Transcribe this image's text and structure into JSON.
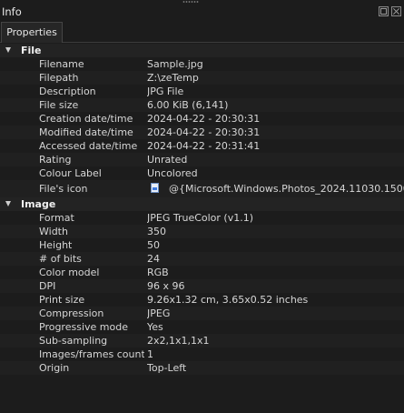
{
  "window": {
    "title": "Info"
  },
  "tabs": [
    {
      "label": "Properties"
    }
  ],
  "sections": [
    {
      "label": "File",
      "rows": [
        {
          "key": "Filename",
          "value": "Sample.jpg"
        },
        {
          "key": "Filepath",
          "value": "Z:\\zeTemp"
        },
        {
          "key": "Description",
          "value": "JPG File"
        },
        {
          "key": "File size",
          "value": "6.00 KiB (6,141)"
        },
        {
          "key": "Creation date/time",
          "value": "2024-04-22 - 20:30:31"
        },
        {
          "key": "Modified date/time",
          "value": "2024-04-22 - 20:30:31"
        },
        {
          "key": "Accessed date/time",
          "value": "2024-04-22 - 20:31:41"
        },
        {
          "key": "Rating",
          "value": "Unrated"
        },
        {
          "key": "Colour Label",
          "value": "Uncolored"
        },
        {
          "key": "File's icon",
          "value": "@{Microsoft.Windows.Photos_2024.11030.15001.",
          "icon": "image-file-icon"
        }
      ]
    },
    {
      "label": "Image",
      "rows": [
        {
          "key": "Format",
          "value": "JPEG TrueColor (v1.1)"
        },
        {
          "key": "Width",
          "value": "350"
        },
        {
          "key": "Height",
          "value": "50"
        },
        {
          "key": "# of bits",
          "value": "24"
        },
        {
          "key": "Color model",
          "value": "RGB"
        },
        {
          "key": "DPI",
          "value": "96 x 96"
        },
        {
          "key": "Print size",
          "value": "9.26x1.32 cm, 3.65x0.52 inches"
        },
        {
          "key": "Compression",
          "value": "JPEG"
        },
        {
          "key": "Progressive mode",
          "value": "Yes"
        },
        {
          "key": "Sub-sampling",
          "value": "2x2,1x1,1x1"
        },
        {
          "key": "Images/frames count",
          "value": "1"
        },
        {
          "key": "Origin",
          "value": "Top-Left"
        }
      ]
    }
  ],
  "icons": {
    "float": "float-window-icon",
    "close": "close-icon",
    "expand": "chevron-down-icon"
  }
}
